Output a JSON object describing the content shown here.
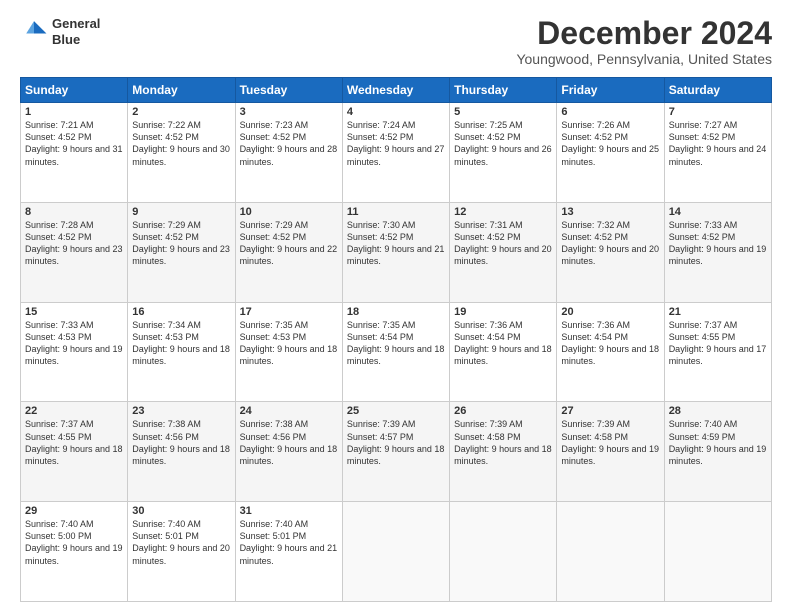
{
  "header": {
    "logo_line1": "General",
    "logo_line2": "Blue",
    "title": "December 2024",
    "subtitle": "Youngwood, Pennsylvania, United States"
  },
  "days_of_week": [
    "Sunday",
    "Monday",
    "Tuesday",
    "Wednesday",
    "Thursday",
    "Friday",
    "Saturday"
  ],
  "weeks": [
    [
      {
        "day": 1,
        "sunrise": "7:21 AM",
        "sunset": "4:52 PM",
        "daylight": "9 hours and 31 minutes."
      },
      {
        "day": 2,
        "sunrise": "7:22 AM",
        "sunset": "4:52 PM",
        "daylight": "9 hours and 30 minutes."
      },
      {
        "day": 3,
        "sunrise": "7:23 AM",
        "sunset": "4:52 PM",
        "daylight": "9 hours and 28 minutes."
      },
      {
        "day": 4,
        "sunrise": "7:24 AM",
        "sunset": "4:52 PM",
        "daylight": "9 hours and 27 minutes."
      },
      {
        "day": 5,
        "sunrise": "7:25 AM",
        "sunset": "4:52 PM",
        "daylight": "9 hours and 26 minutes."
      },
      {
        "day": 6,
        "sunrise": "7:26 AM",
        "sunset": "4:52 PM",
        "daylight": "9 hours and 25 minutes."
      },
      {
        "day": 7,
        "sunrise": "7:27 AM",
        "sunset": "4:52 PM",
        "daylight": "9 hours and 24 minutes."
      }
    ],
    [
      {
        "day": 8,
        "sunrise": "7:28 AM",
        "sunset": "4:52 PM",
        "daylight": "9 hours and 23 minutes."
      },
      {
        "day": 9,
        "sunrise": "7:29 AM",
        "sunset": "4:52 PM",
        "daylight": "9 hours and 23 minutes."
      },
      {
        "day": 10,
        "sunrise": "7:29 AM",
        "sunset": "4:52 PM",
        "daylight": "9 hours and 22 minutes."
      },
      {
        "day": 11,
        "sunrise": "7:30 AM",
        "sunset": "4:52 PM",
        "daylight": "9 hours and 21 minutes."
      },
      {
        "day": 12,
        "sunrise": "7:31 AM",
        "sunset": "4:52 PM",
        "daylight": "9 hours and 20 minutes."
      },
      {
        "day": 13,
        "sunrise": "7:32 AM",
        "sunset": "4:52 PM",
        "daylight": "9 hours and 20 minutes."
      },
      {
        "day": 14,
        "sunrise": "7:33 AM",
        "sunset": "4:52 PM",
        "daylight": "9 hours and 19 minutes."
      }
    ],
    [
      {
        "day": 15,
        "sunrise": "7:33 AM",
        "sunset": "4:53 PM",
        "daylight": "9 hours and 19 minutes."
      },
      {
        "day": 16,
        "sunrise": "7:34 AM",
        "sunset": "4:53 PM",
        "daylight": "9 hours and 18 minutes."
      },
      {
        "day": 17,
        "sunrise": "7:35 AM",
        "sunset": "4:53 PM",
        "daylight": "9 hours and 18 minutes."
      },
      {
        "day": 18,
        "sunrise": "7:35 AM",
        "sunset": "4:54 PM",
        "daylight": "9 hours and 18 minutes."
      },
      {
        "day": 19,
        "sunrise": "7:36 AM",
        "sunset": "4:54 PM",
        "daylight": "9 hours and 18 minutes."
      },
      {
        "day": 20,
        "sunrise": "7:36 AM",
        "sunset": "4:54 PM",
        "daylight": "9 hours and 18 minutes."
      },
      {
        "day": 21,
        "sunrise": "7:37 AM",
        "sunset": "4:55 PM",
        "daylight": "9 hours and 17 minutes."
      }
    ],
    [
      {
        "day": 22,
        "sunrise": "7:37 AM",
        "sunset": "4:55 PM",
        "daylight": "9 hours and 18 minutes."
      },
      {
        "day": 23,
        "sunrise": "7:38 AM",
        "sunset": "4:56 PM",
        "daylight": "9 hours and 18 minutes."
      },
      {
        "day": 24,
        "sunrise": "7:38 AM",
        "sunset": "4:56 PM",
        "daylight": "9 hours and 18 minutes."
      },
      {
        "day": 25,
        "sunrise": "7:39 AM",
        "sunset": "4:57 PM",
        "daylight": "9 hours and 18 minutes."
      },
      {
        "day": 26,
        "sunrise": "7:39 AM",
        "sunset": "4:58 PM",
        "daylight": "9 hours and 18 minutes."
      },
      {
        "day": 27,
        "sunrise": "7:39 AM",
        "sunset": "4:58 PM",
        "daylight": "9 hours and 19 minutes."
      },
      {
        "day": 28,
        "sunrise": "7:40 AM",
        "sunset": "4:59 PM",
        "daylight": "9 hours and 19 minutes."
      }
    ],
    [
      {
        "day": 29,
        "sunrise": "7:40 AM",
        "sunset": "5:00 PM",
        "daylight": "9 hours and 19 minutes."
      },
      {
        "day": 30,
        "sunrise": "7:40 AM",
        "sunset": "5:01 PM",
        "daylight": "9 hours and 20 minutes."
      },
      {
        "day": 31,
        "sunrise": "7:40 AM",
        "sunset": "5:01 PM",
        "daylight": "9 hours and 21 minutes."
      },
      null,
      null,
      null,
      null
    ]
  ]
}
